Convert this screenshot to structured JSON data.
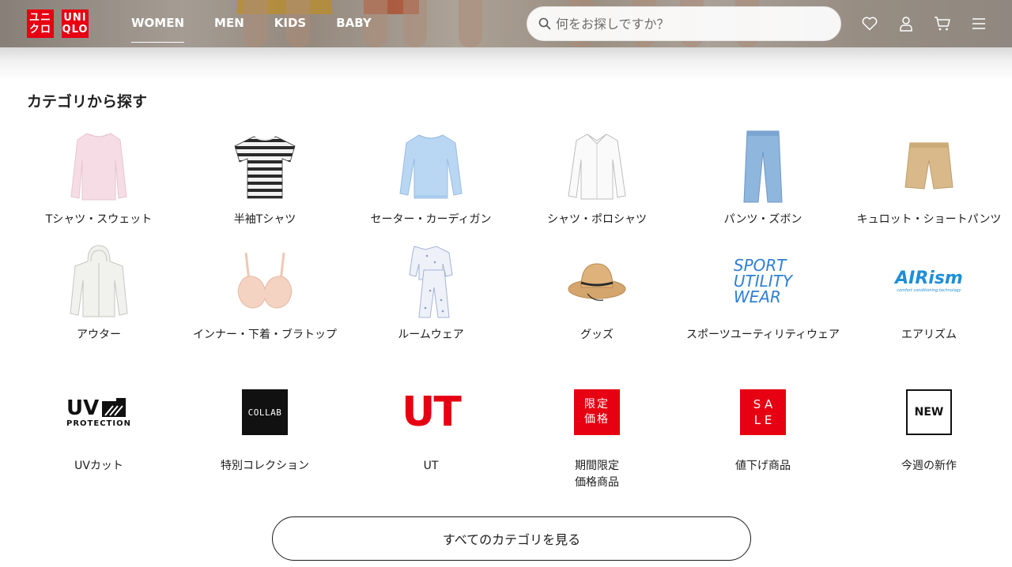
{
  "header": {
    "logo": {
      "top_left": "ユニ",
      "bottom_left": "クロ",
      "top_right": "UNI",
      "bottom_right": "QLO"
    },
    "nav": [
      {
        "label": "WOMEN",
        "active": true
      },
      {
        "label": "MEN",
        "active": false
      },
      {
        "label": "KIDS",
        "active": false
      },
      {
        "label": "BABY",
        "active": false
      }
    ],
    "search": {
      "placeholder": "何をお探しですか？",
      "value": ""
    },
    "icons": [
      "heart-icon",
      "user-icon",
      "cart-icon",
      "menu-icon"
    ]
  },
  "section": {
    "title": "カテゴリから探す"
  },
  "categories": [
    {
      "label": "Tシャツ・スウェット",
      "thumb": "long-sleeve-tee"
    },
    {
      "label": "半袖Tシャツ",
      "thumb": "striped-tee"
    },
    {
      "label": "セーター・カーディガン",
      "thumb": "sweater"
    },
    {
      "label": "シャツ・ポロシャツ",
      "thumb": "shirt"
    },
    {
      "label": "パンツ・ズボン",
      "thumb": "jeans"
    },
    {
      "label": "キュロット・ショートパンツ",
      "thumb": "shorts"
    },
    {
      "label": "アウター",
      "thumb": "hoodie"
    },
    {
      "label": "インナー・下着・ブラトップ",
      "thumb": "bra"
    },
    {
      "label": "ルームウェア",
      "thumb": "pajamas"
    },
    {
      "label": "グッズ",
      "thumb": "bucket-hat"
    },
    {
      "label": "スポーツユーティリティウェア",
      "thumb": "sport-utility-wear-logo",
      "logo_lines": [
        "SPORT",
        "UTILITY",
        "WEAR"
      ]
    },
    {
      "label": "エアリズム",
      "thumb": "airism-logo",
      "logo_text": "AIRism",
      "logo_sub": "comfort conditioning technology"
    },
    {
      "label": "UVカット",
      "thumb": "uv-protection-logo",
      "logo_text": "UV",
      "logo_sub": "PROTECTION"
    },
    {
      "label": "特別コレクション",
      "thumb": "collab-badge",
      "logo_text": "COLLAB"
    },
    {
      "label": "UT",
      "thumb": "ut-logo",
      "logo_text": "UT"
    },
    {
      "label": "期間限定\n価格商品",
      "thumb": "limited-price-badge",
      "logo_lines": [
        "限定",
        "価格"
      ]
    },
    {
      "label": "値下げ商品",
      "thumb": "sale-badge",
      "logo_lines": [
        "S A",
        "L E"
      ]
    },
    {
      "label": "今週の新作",
      "thumb": "new-badge",
      "logo_text": "NEW"
    }
  ],
  "colors": {
    "brand_red": "#e60012",
    "sport_blue": "#2f7fd6",
    "airism_blue": "#1e8fd6"
  },
  "all_button": {
    "label": "すべてのカテゴリを見る"
  }
}
